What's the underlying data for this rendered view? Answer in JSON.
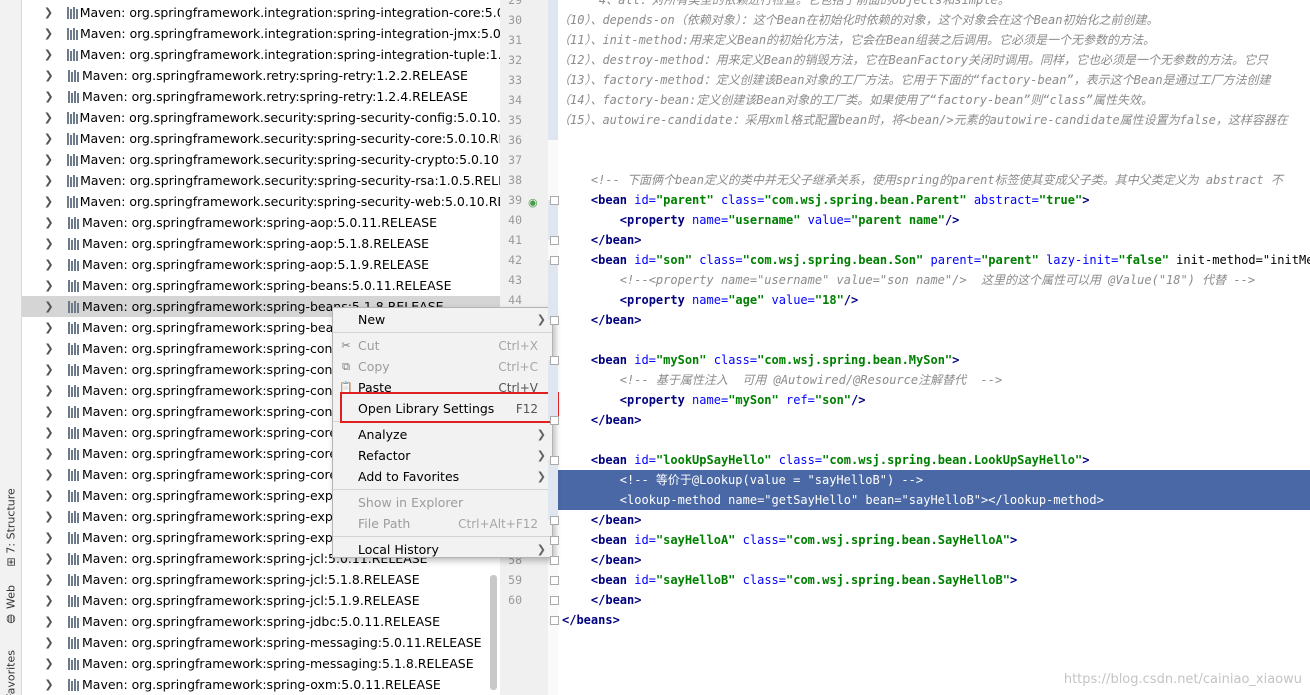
{
  "tool_strip": {
    "tabs": [
      {
        "label": "7: Structure",
        "icon": "structure-icon",
        "glyph": "⊞"
      },
      {
        "label": "Web",
        "icon": "web-icon",
        "glyph": "◍"
      },
      {
        "label": "Favorites",
        "icon": "favorites-icon",
        "glyph": ""
      }
    ]
  },
  "tree": {
    "items": [
      {
        "text": "Maven: org.springframework.integration:spring-integration-core:5.0.10.R"
      },
      {
        "text": "Maven: org.springframework.integration:spring-integration-jmx:5.0.10.R"
      },
      {
        "text": "Maven: org.springframework.integration:spring-integration-tuple:1.0.0.R"
      },
      {
        "text": "Maven: org.springframework.retry:spring-retry:1.2.2.RELEASE"
      },
      {
        "text": "Maven: org.springframework.retry:spring-retry:1.2.4.RELEASE"
      },
      {
        "text": "Maven: org.springframework.security:spring-security-config:5.0.10.RELEA"
      },
      {
        "text": "Maven: org.springframework.security:spring-security-core:5.0.10.RELEAS"
      },
      {
        "text": "Maven: org.springframework.security:spring-security-crypto:5.0.10.RELE"
      },
      {
        "text": "Maven: org.springframework.security:spring-security-rsa:1.0.5.RELEASE"
      },
      {
        "text": "Maven: org.springframework.security:spring-security-web:5.0.10.RELEAS"
      },
      {
        "text": "Maven: org.springframework:spring-aop:5.0.11.RELEASE"
      },
      {
        "text": "Maven: org.springframework:spring-aop:5.1.8.RELEASE"
      },
      {
        "text": "Maven: org.springframework:spring-aop:5.1.9.RELEASE"
      },
      {
        "text": "Maven: org.springframework:spring-beans:5.0.11.RELEASE"
      },
      {
        "text": "Maven: org.springframework:spring-beans:5.1.8.RELEASE",
        "selected": true
      },
      {
        "text": "Maven: org.springframework:spring-beans"
      },
      {
        "text": "Maven: org.springframework:spring-contex"
      },
      {
        "text": "Maven: org.springframework:spring-contex"
      },
      {
        "text": "Maven: org.springframework:spring-contex"
      },
      {
        "text": "Maven: org.springframework:spring-contex"
      },
      {
        "text": "Maven: org.springframework:spring-core:5"
      },
      {
        "text": "Maven: org.springframework:spring-core:5"
      },
      {
        "text": "Maven: org.springframework:spring-core:5"
      },
      {
        "text": "Maven: org.springframework:spring-expres"
      },
      {
        "text": "Maven: org.springframework:spring-expres"
      },
      {
        "text": "Maven: org.springframework:spring-expres"
      },
      {
        "text": "Maven: org.springframework:spring-jcl:5.0.11.RELEASE"
      },
      {
        "text": "Maven: org.springframework:spring-jcl:5.1.8.RELEASE"
      },
      {
        "text": "Maven: org.springframework:spring-jcl:5.1.9.RELEASE"
      },
      {
        "text": "Maven: org.springframework:spring-jdbc:5.0.11.RELEASE"
      },
      {
        "text": "Maven: org.springframework:spring-messaging:5.0.11.RELEASE"
      },
      {
        "text": "Maven: org.springframework:spring-messaging:5.1.8.RELEASE"
      },
      {
        "text": "Maven: org.springframework:spring-oxm:5.0.11.RELEASE"
      }
    ]
  },
  "gutter": {
    "line_numbers": [
      "29",
      "30",
      "31",
      "32",
      "33",
      "34",
      "35",
      "36",
      "37",
      "38",
      "39",
      "40",
      "41",
      "42",
      "43",
      "44",
      "",
      "",
      "",
      "",
      "",
      "",
      "",
      "",
      "",
      "",
      "",
      "57",
      "58",
      "59",
      "60"
    ]
  },
  "editor": {
    "lines": [
      {
        "text": "    4、all：对所有类型的依赖进行检查。它包括了前面的objects和simple。",
        "kind": "doc"
      },
      {
        "text": "（10）、depends-on（依赖对象）：这个Bean在初始化时依赖的对象，这个对象会在这个Bean初始化之前创建。",
        "kind": "doc2"
      },
      {
        "text": "（11）、init-method:用来定义Bean的初始化方法，它会在Bean组装之后调用。它必须是一个无参数的方法。",
        "kind": "doc2"
      },
      {
        "text": "（12）、destroy-method：用来定义Bean的销毁方法，它在BeanFactory关闭时调用。同样，它也必须是一个无参数的方法。它只",
        "kind": "doc2"
      },
      {
        "text": "（13）、factory-method：定义创建该Bean对象的工厂方法。它用于下面的“factory-bean”，表示这个Bean是通过工厂方法创建",
        "kind": "doc2"
      },
      {
        "text": "（14）、factory-bean:定义创建该Bean对象的工厂类。如果使用了“factory-bean”则“class”属性失效。",
        "kind": "doc2"
      },
      {
        "text": "（15）、autowire-candidate：采用xml格式配置bean时，将<bean/>元素的autowire-candidate属性设置为false，这样容器在",
        "kind": "doc2"
      },
      {
        "text": "",
        "kind": "code"
      },
      {
        "text": "",
        "kind": "code"
      },
      {
        "text": "    <!-- 下面俩个bean定义的类中并无父子继承关系，使用spring的parent标签使其变成父子类。其中父类定义为 abstract 不",
        "kind": "comment"
      },
      {
        "text": "    <bean id=\"parent\" class=\"com.wsj.spring.bean.Parent\" abstract=\"true\">",
        "kind": "code"
      },
      {
        "text": "        <property name=\"username\" value=\"parent name\"/>",
        "kind": "code"
      },
      {
        "text": "    </bean>",
        "kind": "code"
      },
      {
        "text": "    <bean id=\"son\" class=\"com.wsj.spring.bean.Son\" parent=\"parent\" lazy-init=\"false\" init-method=\"initMethod",
        "kind": "code"
      },
      {
        "text": "        <!--<property name=\"username\" value=\"son name\"/>  这里的这个属性可以用 @Value(\"18\") 代替 -->",
        "kind": "comment"
      },
      {
        "text": "        <property name=\"age\" value=\"18\"/>",
        "kind": "code"
      },
      {
        "text": "    </bean>",
        "kind": "code"
      },
      {
        "text": "",
        "kind": "code"
      },
      {
        "text": "    <bean id=\"mySon\" class=\"com.wsj.spring.bean.MySon\">",
        "kind": "code"
      },
      {
        "text": "        <!-- 基于属性注入  可用 @Autowired/@Resource注解替代  -->",
        "kind": "comment"
      },
      {
        "text": "        <property name=\"mySon\" ref=\"son\"/>",
        "kind": "code"
      },
      {
        "text": "    </bean>",
        "kind": "code"
      },
      {
        "text": "",
        "kind": "code"
      },
      {
        "text": "    <bean id=\"lookUpSayHello\" class=\"com.wsj.spring.bean.LookUpSayHello\">",
        "kind": "code"
      },
      {
        "text": "        <!-- 等价于@Lookup(value = \"sayHelloB\") -->",
        "kind": "hl"
      },
      {
        "text": "        <lookup-method name=\"getSayHello\" bean=\"sayHelloB\"></lookup-method>",
        "kind": "hl"
      },
      {
        "text": "    </bean>",
        "kind": "code"
      },
      {
        "text": "    <bean id=\"sayHelloA\" class=\"com.wsj.spring.bean.SayHelloA\">",
        "kind": "code"
      },
      {
        "text": "    </bean>",
        "kind": "code"
      },
      {
        "text": "    <bean id=\"sayHelloB\" class=\"com.wsj.spring.bean.SayHelloB\">",
        "kind": "code"
      },
      {
        "text": "    </bean>",
        "kind": "code"
      },
      {
        "text": "</beans>",
        "kind": "code"
      }
    ],
    "watermark": "https://blog.csdn.net/cainiao_xiaowu"
  },
  "context_menu": {
    "items": [
      {
        "label": "New",
        "shortcut": "",
        "submenu": true,
        "enabled": true,
        "icon": ""
      },
      {
        "sep": true
      },
      {
        "label": "Cut",
        "shortcut": "Ctrl+X",
        "submenu": false,
        "enabled": false,
        "icon": "✂"
      },
      {
        "label": "Copy",
        "shortcut": "Ctrl+C",
        "submenu": false,
        "enabled": false,
        "icon": "⧉"
      },
      {
        "label": "Paste",
        "shortcut": "Ctrl+V",
        "submenu": false,
        "enabled": true,
        "icon": "📋"
      },
      {
        "label": "Open Library Settings",
        "shortcut": "F12",
        "submenu": false,
        "enabled": true,
        "icon": ""
      },
      {
        "sep": true
      },
      {
        "label": "Analyze",
        "shortcut": "",
        "submenu": true,
        "enabled": true,
        "icon": ""
      },
      {
        "label": "Refactor",
        "shortcut": "",
        "submenu": true,
        "enabled": true,
        "icon": ""
      },
      {
        "label": "Add to Favorites",
        "shortcut": "",
        "submenu": true,
        "enabled": true,
        "icon": ""
      },
      {
        "sep": true
      },
      {
        "label": "Show in Explorer",
        "shortcut": "",
        "submenu": false,
        "enabled": false,
        "icon": ""
      },
      {
        "label": "File Path",
        "shortcut": "Ctrl+Alt+F12",
        "submenu": false,
        "enabled": false,
        "icon": ""
      },
      {
        "sep": true
      },
      {
        "label": "Local History",
        "shortcut": "",
        "submenu": true,
        "enabled": true,
        "icon": ""
      }
    ]
  },
  "colors": {
    "tag": "#000080",
    "attr": "#0000ff",
    "value": "#008000",
    "comment": "#8c8c8c",
    "selection": "#4a68a6",
    "highlight_box": "#e02020"
  }
}
